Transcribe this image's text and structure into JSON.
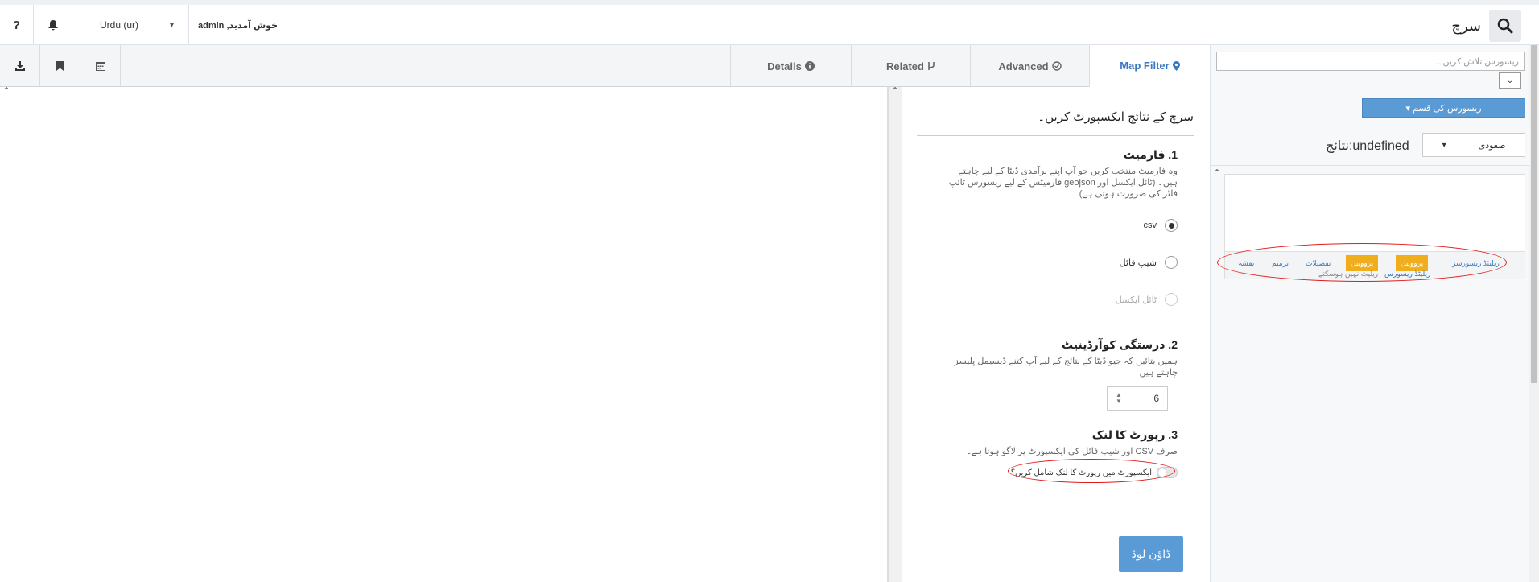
{
  "topbar": {
    "help_icon_glyph": "?",
    "language_label": "Urdu (ur)",
    "language_caret": "▾",
    "welcome_text": "خوش آمدید, admin",
    "search_title": "سرچ"
  },
  "tabs": {
    "map_filter": "Map Filter",
    "advanced": "Advanced",
    "related": "Related",
    "details": "Details"
  },
  "export": {
    "title": "سرچ کے نتائج ایکسپورٹ کریں۔",
    "format_heading": "1. فارمیٹ",
    "format_desc": "وہ فارمیٹ منتخب کریں جو آپ اپنے برآمدی ڈیٹا کے لیے چاہتے ہیں۔ (ٹائل ایکسل اور geojson فارمیٹس کے لیے ریسورس ٹائپ فلٹر کی ضرورت ہوتی ہے)",
    "options": [
      {
        "label": "csv",
        "selected": true,
        "disabled": false
      },
      {
        "label": "شیپ فائل",
        "selected": false,
        "disabled": false
      },
      {
        "label": "ٹائل ایکسل",
        "selected": false,
        "disabled": true
      }
    ],
    "precision_heading": "2. درستگی کوآرڈینیٹ",
    "precision_desc": "ہمیں بتائیں کہ جیو ڈیٹا کے نتائج کے لیے آپ کتنے ڈیسیمل پلیسز چاہتے ہیں",
    "precision_value": "6",
    "report_heading": "3. رپورٹ کا لنک",
    "report_desc": "صرف CSV اور شیپ فائل کی ایکسپورٹ پر لاگو ہوتا ہے۔",
    "report_toggle_label": "ایکسپورٹ میں رپورٹ کا لنک شامل کریں؟",
    "download_label": "ڈاؤن لوڈ"
  },
  "sidebar": {
    "search_placeholder": "ریسورس تلاش کریں...",
    "caret": "⌄",
    "resource_type_label": "ریسورس کی قسم ▾",
    "sort_value": "صعودی",
    "sort_caret": "▾",
    "results_label": "نتائج:undefined",
    "card": {
      "related_link": "ریلیٹڈ ریسورسز",
      "badge1": "پرووینل",
      "badge2": "پرووینل",
      "details_link": "تفصیلات",
      "edit_link": "ترمیم",
      "map_link": "نقشہ",
      "related_link2": "ریلیٹڈ ریسورس",
      "cannot_relate": "ریلیٹ نہیں ہوسکتے"
    }
  },
  "colors": {
    "accent": "#3a78c2",
    "button_blue": "#5b9bd5",
    "badge_orange": "#f0ad1c",
    "annotation_red": "#e01b1b"
  }
}
